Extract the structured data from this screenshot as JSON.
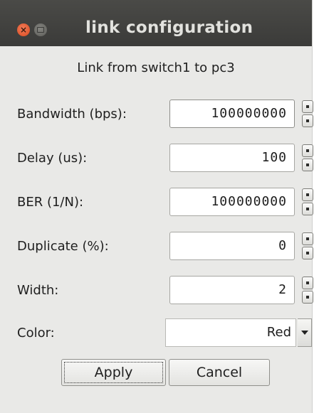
{
  "window": {
    "title": "link configuration",
    "close_symbol": "×"
  },
  "subtitle": "Link from switch1 to pc3",
  "fields": [
    {
      "label": "Bandwidth (bps):",
      "value": "100000000"
    },
    {
      "label": "Delay (us):",
      "value": "100"
    },
    {
      "label": "BER (1/N):",
      "value": "100000000"
    },
    {
      "label": "Duplicate (%):",
      "value": "0"
    },
    {
      "label": "Width:",
      "value": "2"
    }
  ],
  "color": {
    "label": "Color:",
    "value": "Red"
  },
  "buttons": {
    "apply": "Apply",
    "cancel": "Cancel"
  },
  "icons": {
    "close": "close-icon",
    "minimize": "minimize-icon",
    "spinner": "spinner-arrows-icon",
    "dropdown": "chevron-down-icon"
  },
  "colors": {
    "titlebar": "#3e3e3c",
    "close_button": "#e9572a",
    "dialog_background": "#e9e9e7"
  }
}
